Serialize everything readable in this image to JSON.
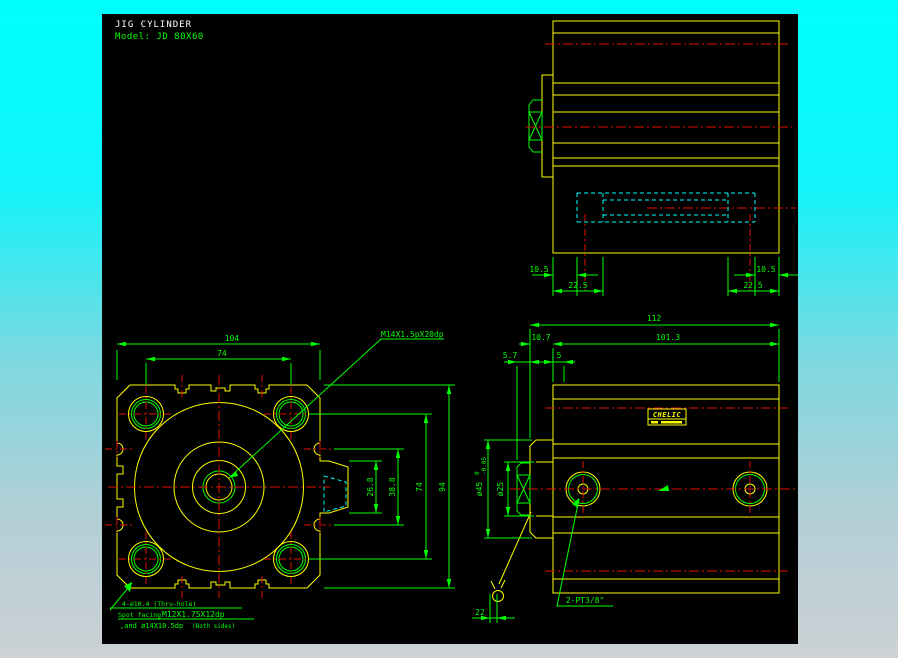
{
  "title": {
    "product": "JIG CYLINDER",
    "model": "Model: JD 80X60"
  },
  "colors": {
    "background_top": "#00ffff",
    "background_bottom": "#ccd1d5",
    "canvas": "#000000",
    "outline": "#ffff00",
    "dimension": "#00ff00",
    "centerline": "#dd1000",
    "hidden_line": "#00ffff",
    "title_text": "#ffffff"
  },
  "top_view": {
    "dims": {
      "left_hole_offset": "10.5",
      "left_hole_span": "22.5",
      "right_hole_offset": "10.5",
      "right_hole_span": "22.5"
    }
  },
  "side_view": {
    "brand_label": "CHELIC",
    "dims": {
      "overall_length": "112",
      "head_thickness": "10.7",
      "body_length": "101.3",
      "fitting_protrusion": "5.7",
      "step": "5",
      "boss_dia": "ø45",
      "boss_tol_upper": "0",
      "boss_tol_lower": "-0.05",
      "step_dia": "ø25",
      "fitting_width": "22",
      "port_label": "2-PT3/8\""
    }
  },
  "front_view": {
    "thread_label": "M14X1.5pX20dp",
    "dims": {
      "width": "104",
      "bolt_span_h": "74",
      "pocket_depth": "26.8",
      "boss_depth": "38.8",
      "bolt_span_v": "74",
      "height": "94"
    },
    "notes": {
      "l1": "4-ø10.4 (Thru-hole)",
      "l2a": "Spot facing",
      "l2b": "M12X1.75X12dp",
      "l3a": ",and ø14X10.5dp",
      "l3b": "(Both sides)"
    }
  }
}
